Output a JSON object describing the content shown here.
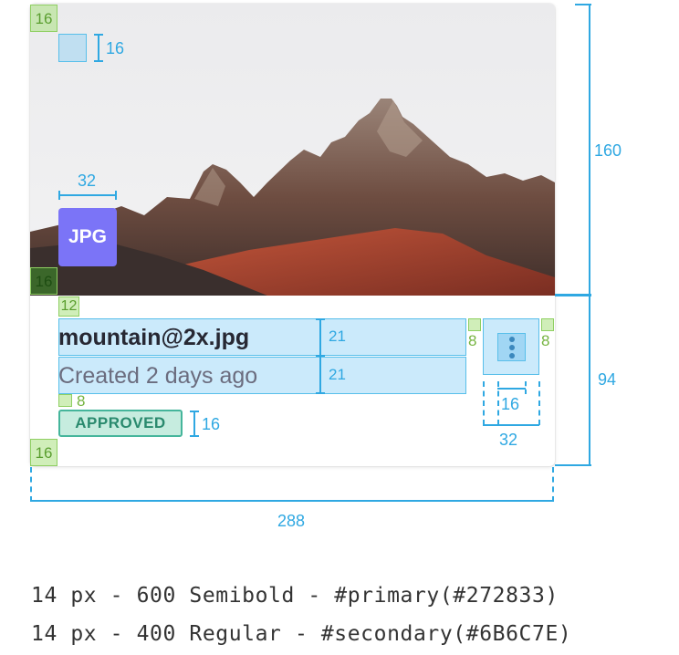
{
  "card": {
    "file_type": "JPG",
    "title": "mountain@2x.jpg",
    "subtitle": "Created 2 days ago",
    "status": "APPROVED"
  },
  "annotations": {
    "image_height": "160",
    "body_height": "94",
    "card_width": "288",
    "padding_top_left": "16",
    "icon_top_size": "16",
    "badge_width": "32",
    "padding_bottom_left_image": "16",
    "title_top_gap": "12",
    "title_height": "21",
    "subtitle_height": "21",
    "gap_left_of_menu": "8",
    "gap_right_of_menu": "8",
    "status_gap": "8",
    "status_height": "16",
    "padding_bottom": "16",
    "menu_icon_size": "16",
    "menu_button_size": "32"
  },
  "specs": [
    "14 px - 600 Semibold - #primary(#272833)",
    "14 px - 400 Regular - #secondary(#6B6C7E)"
  ],
  "colors": {
    "primary": "#272833",
    "secondary": "#6B6C7E",
    "badge": "#7B74F7",
    "status_text": "#2A8A6E",
    "annotation_blue": "#2FA8E2",
    "annotation_green": "#8FCF62"
  }
}
